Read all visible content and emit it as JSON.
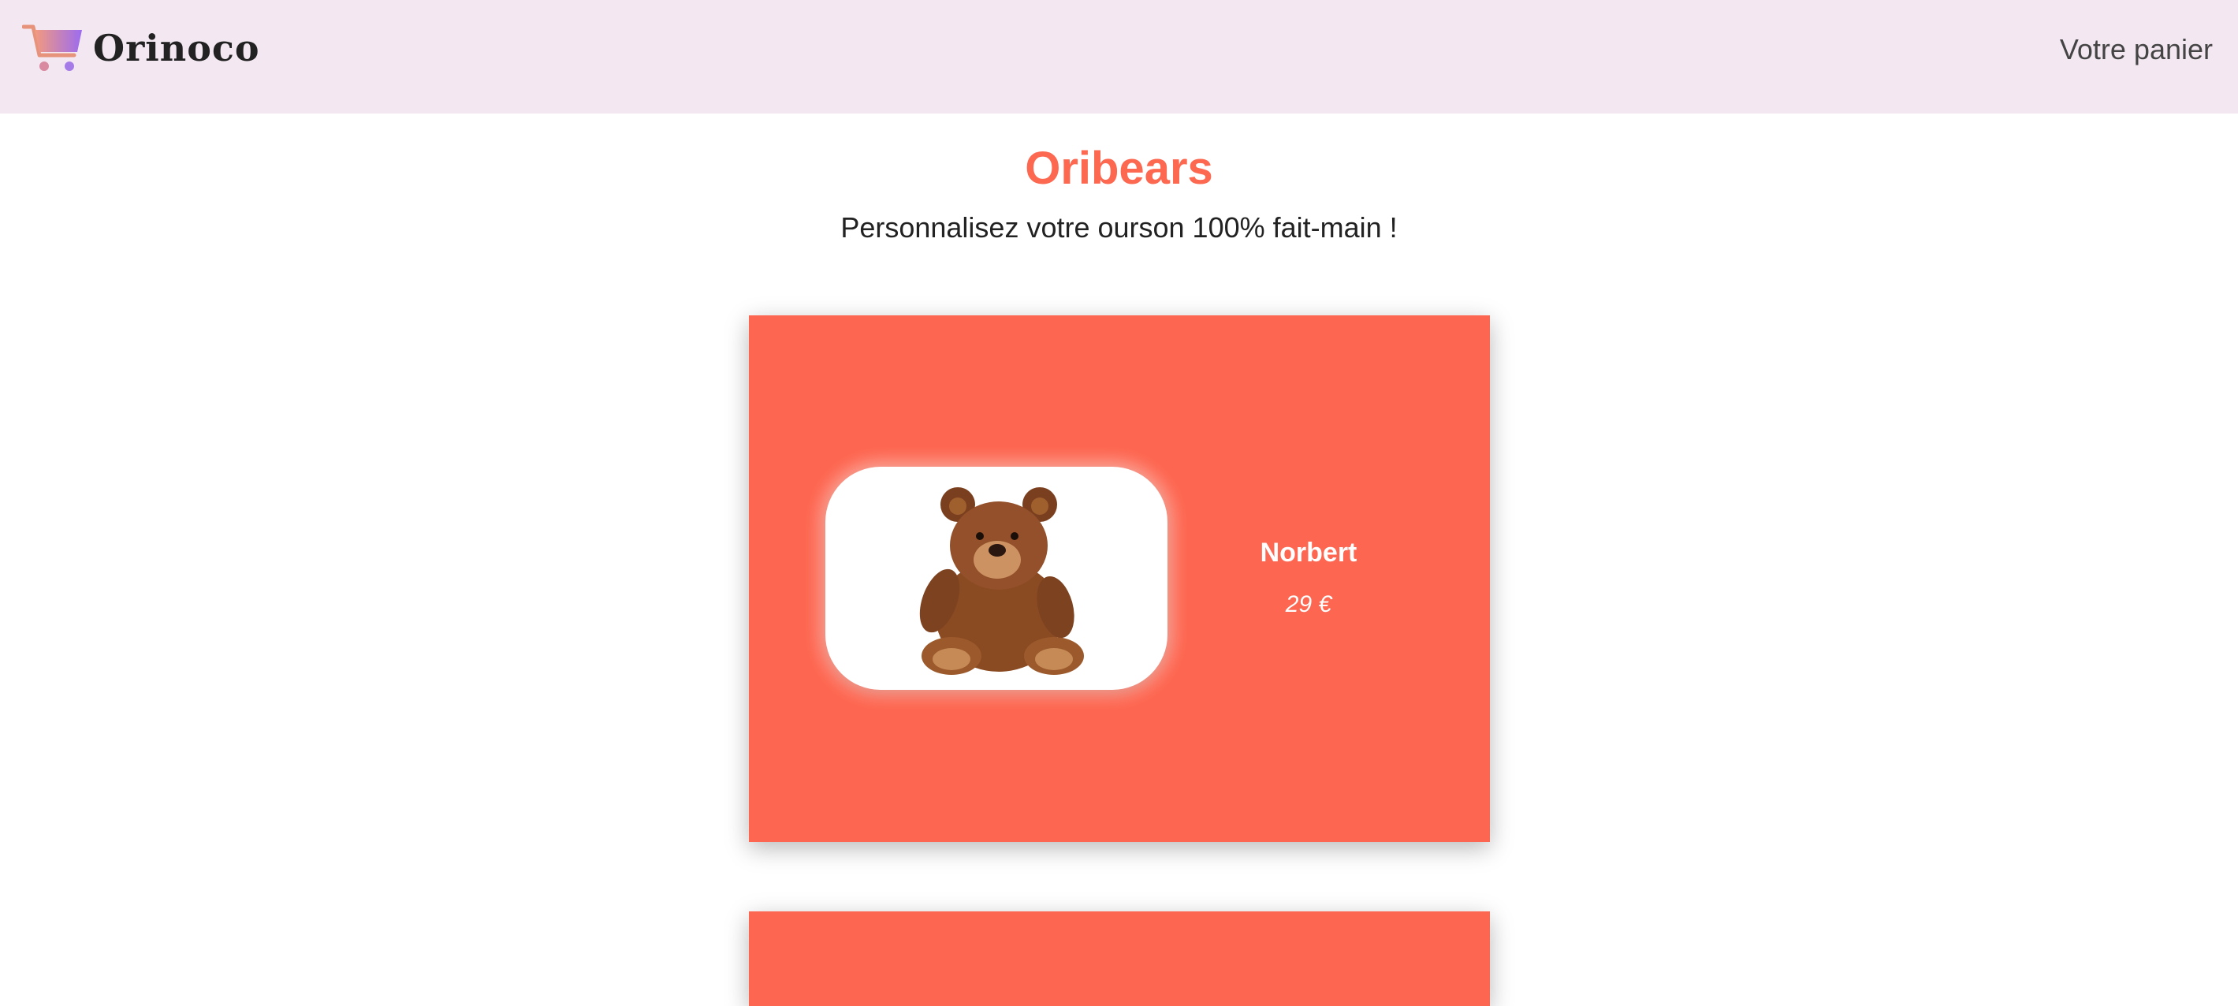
{
  "header": {
    "brand": "Orinoco",
    "cart_link": "Votre panier"
  },
  "hero": {
    "title": "Oribears",
    "subtitle": "Personnalisez votre ourson 100% fait-main !"
  },
  "products": [
    {
      "name": "Norbert",
      "price": "29 €",
      "image": "teddy-bear-brown"
    }
  ],
  "colors": {
    "header_bg": "#f3e8f1",
    "accent": "#fd6850",
    "card_bg": "#fd6650"
  }
}
